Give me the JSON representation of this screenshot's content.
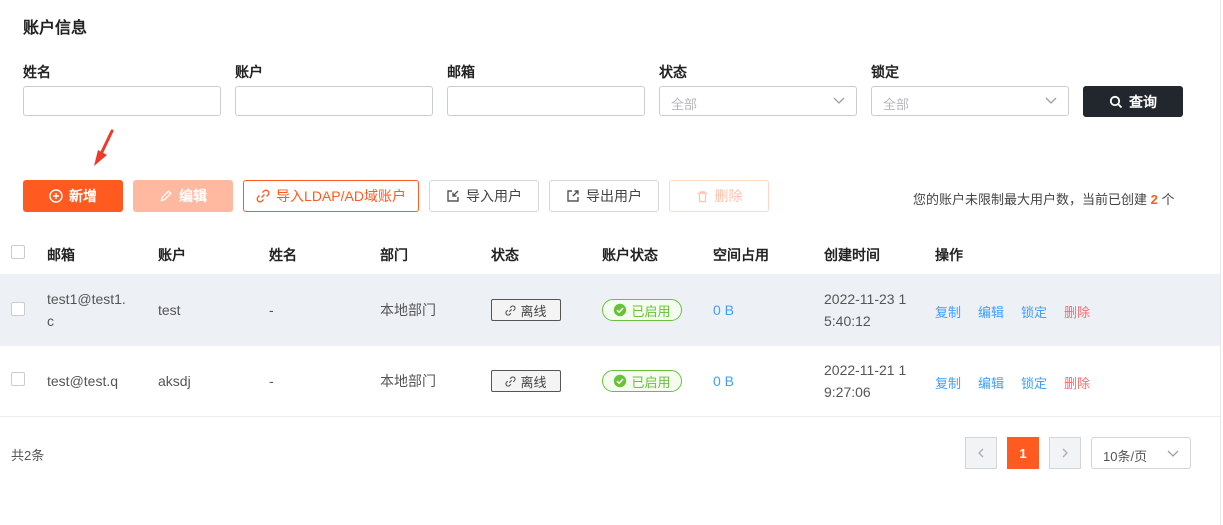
{
  "page": {
    "title": "账户信息"
  },
  "filters": {
    "name_label": "姓名",
    "account_label": "账户",
    "email_label": "邮箱",
    "status_label": "状态",
    "status_value": "全部",
    "lock_label": "锁定",
    "lock_value": "全部",
    "search_label": "查询"
  },
  "toolbar": {
    "add_label": "新增",
    "edit_label": "编辑",
    "ldap_label": "导入LDAP/AD域账户",
    "import_label": "导入用户",
    "export_label": "导出用户",
    "delete_label": "删除",
    "quota_prefix": "您的账户未限制最大用户数，当前已创建",
    "quota_count": "2",
    "quota_suffix": "个"
  },
  "table": {
    "headers": [
      "邮箱",
      "账户",
      "姓名",
      "部门",
      "状态",
      "账户状态",
      "空间占用",
      "创建时间",
      "操作"
    ],
    "rows": [
      {
        "email_line1": "test1@test1.",
        "email_line2": "c",
        "account": "test",
        "name": "-",
        "dept": "本地部门",
        "status": "离线",
        "account_status": "已启用",
        "space": "0 B",
        "created_line1": "2022-11-23 1",
        "created_line2": "5:40:12",
        "actions": {
          "copy": "复制",
          "edit": "编辑",
          "lock": "锁定",
          "delete": "删除"
        }
      },
      {
        "email_line1": "test@test.q",
        "email_line2": "",
        "account": "aksdj",
        "name": "-",
        "dept": "本地部门",
        "status": "离线",
        "account_status": "已启用",
        "space": "0 B",
        "created_line1": "2022-11-21 1",
        "created_line2": "9:27:06",
        "actions": {
          "copy": "复制",
          "edit": "编辑",
          "lock": "锁定",
          "delete": "删除"
        }
      }
    ]
  },
  "pagination": {
    "total": "共2条",
    "current": "1",
    "page_size": "10条/页"
  },
  "colors": {
    "accent": "#ff5a1f",
    "link": "#409eff",
    "danger": "#f56c6c",
    "success": "#67c23a",
    "dark_button": "#22272e"
  },
  "icons": {
    "search": "search-icon",
    "select": "chevron-down-icon",
    "add": "plus-circle-icon",
    "edit": "pencil-icon",
    "ldap": "link-icon",
    "import": "import-icon",
    "export": "export-icon",
    "delete": "trash-icon",
    "status_offline": "link-icon",
    "status_enabled": "check-circle-icon",
    "annotation": "red-arrow-icon"
  }
}
